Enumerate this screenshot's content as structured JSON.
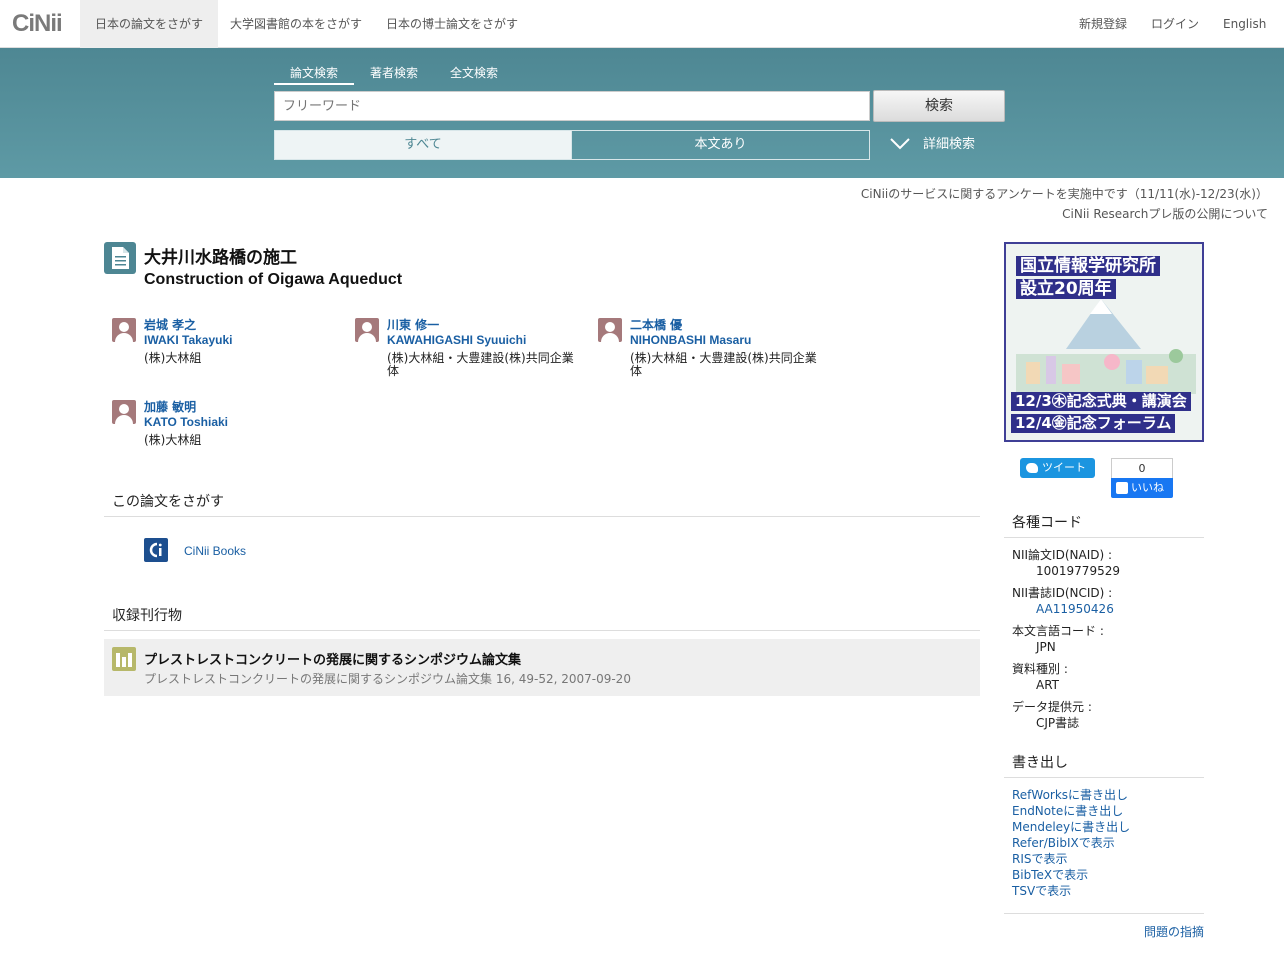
{
  "header": {
    "logo": "CiNii",
    "tabs": [
      "日本の論文をさがす",
      "大学図書館の本をさがす",
      "日本の博士論文をさがす"
    ],
    "links": [
      "新規登録",
      "ログイン",
      "English"
    ]
  },
  "search": {
    "tabs": [
      "論文検索",
      "著者検索",
      "全文検索"
    ],
    "placeholder": "フリーワード",
    "button": "検索",
    "filters": [
      "すべて",
      "本文あり"
    ],
    "advanced": "詳細検索"
  },
  "notices": [
    "CiNiiのサービスに関するアンケートを実施中です（11/11(水)-12/23(水)）",
    "CiNii Researchプレ版の公開について"
  ],
  "article": {
    "title_ja": "大井川水路橋の施工",
    "title_en": "Construction of Oigawa Aqueduct"
  },
  "authors": [
    {
      "name_ja": "岩城 孝之",
      "name_en": "IWAKI Takayuki",
      "affiliation": "(株)大林組"
    },
    {
      "name_ja": "川東 修一",
      "name_en": "KAWAHIGASHI Syuuichi",
      "affiliation": "(株)大林組・大豊建設(株)共同企業体"
    },
    {
      "name_ja": "二本橋 優",
      "name_en": "NIHONBASHI Masaru",
      "affiliation": "(株)大林組・大豊建設(株)共同企業体"
    },
    {
      "name_ja": "加藤 敏明",
      "name_en": "KATO Toshiaki",
      "affiliation": "(株)大林組"
    }
  ],
  "find": {
    "heading": "この論文をさがす",
    "link": "CiNii Books"
  },
  "journal": {
    "heading": "収録刊行物",
    "title": "プレストレストコンクリートの発展に関するシンポジウム論文集",
    "citation": "プレストレストコンクリートの発展に関するシンポジウム論文集 16, 49-52, 2007-09-20"
  },
  "banner": {
    "line1": "国立情報学研究所",
    "line2": "設立20周年",
    "line3": "12/3㊍記念式典・講演会",
    "line4": "12/4㊎記念フォーラム"
  },
  "social": {
    "tweet": "ツイート",
    "like_count": "0",
    "like": "いいね"
  },
  "codes": {
    "heading": "各種コード",
    "items": [
      {
        "label": "NII論文ID(NAID) :",
        "value": "10019779529"
      },
      {
        "label": "NII書誌ID(NCID) :",
        "value": "AA11950426"
      },
      {
        "label": "本文言語コード :",
        "value": "JPN"
      },
      {
        "label": "資料種別 :",
        "value": "ART"
      },
      {
        "label": "データ提供元 :",
        "value": "CJP書誌"
      }
    ]
  },
  "export": {
    "heading": "書き出し",
    "items": [
      "RefWorksに書き出し",
      "EndNoteに書き出し",
      "Mendeleyに書き出し",
      "Refer/BibIXで表示",
      "RISで表示",
      "BibTeXで表示",
      "TSVで表示"
    ]
  },
  "report": "問題の指摘",
  "colors": {
    "band": "#4e8793",
    "link": "#1a5fa3",
    "avatar": "#a5797b",
    "banner": "#2f2f8a"
  }
}
